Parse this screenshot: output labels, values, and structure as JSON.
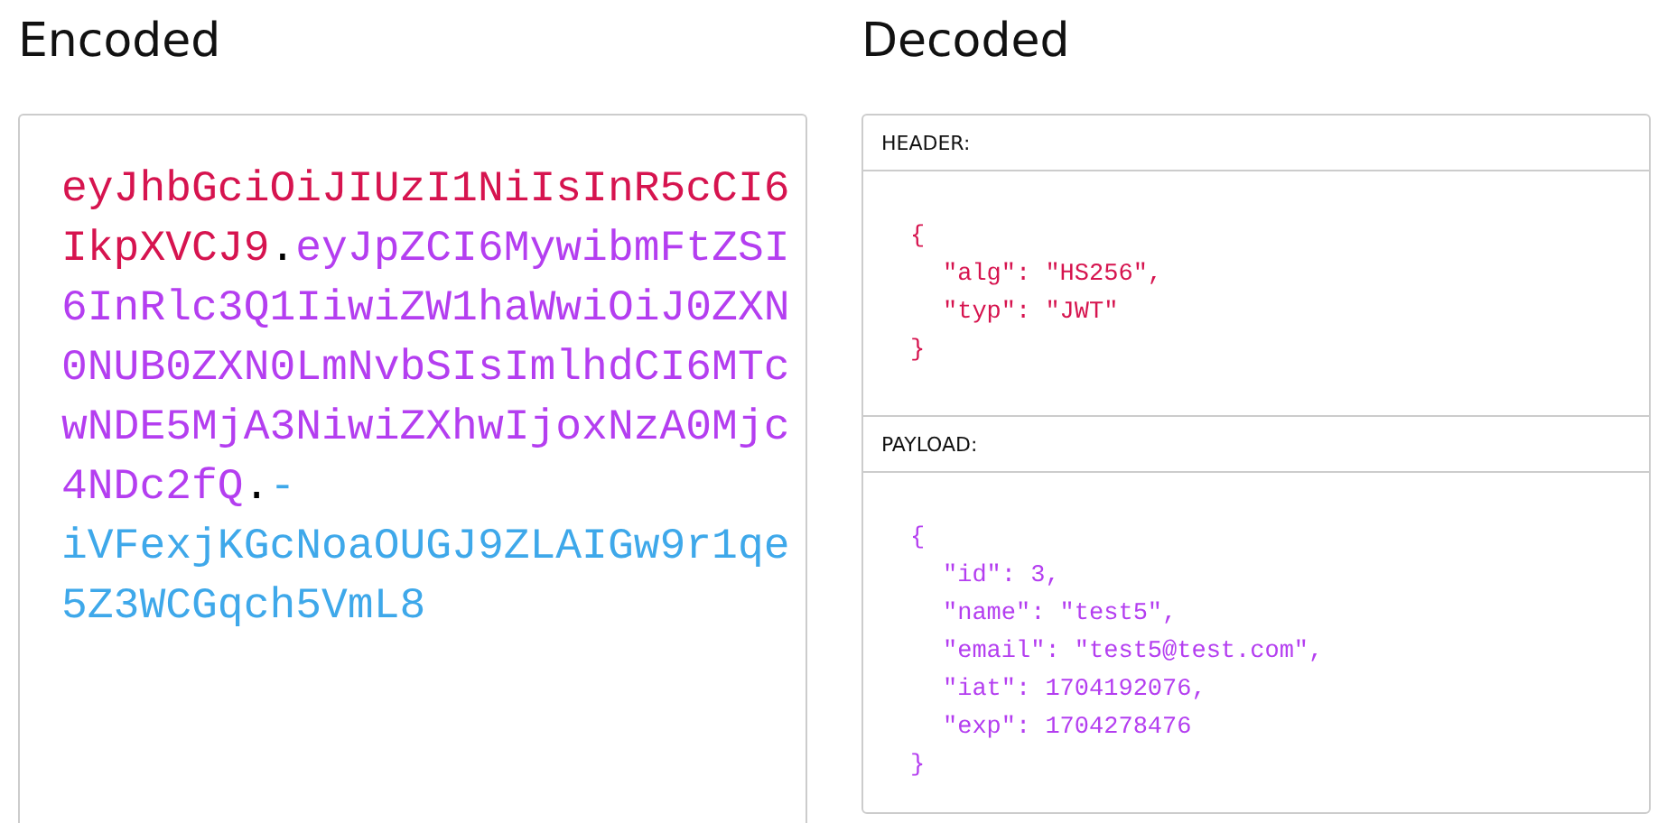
{
  "encoded": {
    "title": "Encoded",
    "lines": [
      [
        {
          "text": "eyJhbGciOiJIUzI1NiIsInR5cCI6",
          "color": "#d6144f"
        }
      ],
      [
        {
          "text": "IkpXVCJ9",
          "color": "#d6144f"
        },
        {
          "text": ".",
          "color": "#000000"
        },
        {
          "text": "eyJpZCI6MywibmFtZSI",
          "color": "#b43ef0"
        }
      ],
      [
        {
          "text": "6InRlc3Q1IiwiZW1haWwiOiJ0ZXN",
          "color": "#b43ef0"
        }
      ],
      [
        {
          "text": "0NUB0ZXN0LmNvbSIsImlhdCI6MTc",
          "color": "#b43ef0"
        }
      ],
      [
        {
          "text": "wNDE5MjA3NiwiZXhwIjoxNzA0Mjc",
          "color": "#b43ef0"
        }
      ],
      [
        {
          "text": "4NDc2fQ",
          "color": "#b43ef0"
        },
        {
          "text": ".",
          "color": "#000000"
        },
        {
          "text": "-",
          "color": "#3ea8ea"
        }
      ],
      [
        {
          "text": "iVFexjKGcNoaOUGJ9ZLAIGw9r1qe",
          "color": "#3ea8ea"
        }
      ],
      [
        {
          "text": "5Z3WCGqch5VmL8",
          "color": "#3ea8ea"
        }
      ]
    ]
  },
  "decoded": {
    "title": "Decoded",
    "sections": [
      {
        "label": "HEADER:",
        "color": "#d6144f",
        "open": "{",
        "fields": [
          "\"alg\": \"HS256\",",
          "\"typ\": \"JWT\""
        ],
        "close": "}"
      },
      {
        "label": "PAYLOAD:",
        "color": "#b43ef0",
        "open": "{",
        "fields": [
          "\"id\": 3,",
          "\"name\": \"test5\",",
          "\"email\": \"test5@test.com\",",
          "\"iat\": 1704192076,",
          "\"exp\": 1704278476"
        ],
        "close": "}"
      }
    ]
  }
}
